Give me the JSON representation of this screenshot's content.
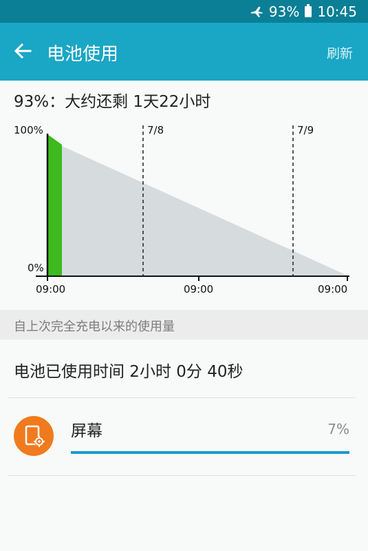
{
  "status_bar": {
    "battery": "93%",
    "time": "10:45",
    "icons": [
      "airplane-mode-icon",
      "battery-icon"
    ]
  },
  "app_bar": {
    "title": "电池使用",
    "refresh_label": "刷新",
    "icon": "back-arrow-icon"
  },
  "summary": {
    "text": "93%：大约还剩 1天22小时"
  },
  "chart_data": {
    "type": "area",
    "y_tick_labels": [
      "100%",
      "0%"
    ],
    "x_tick_labels": [
      "09:00",
      "09:00",
      "09:00"
    ],
    "day_markers": [
      "7/8",
      "7/9"
    ],
    "ylim": [
      0,
      100
    ],
    "series": [
      {
        "values": [
          100,
          93
        ],
        "color": "#3cba1e"
      },
      {
        "values": [
          93,
          0
        ],
        "color": "#d3d8db"
      }
    ]
  },
  "section_header": "自上次完全充电以来的使用量",
  "usage_time": "电池已使用时间 2小时 0分 40秒",
  "apps": [
    {
      "name": "屏幕",
      "percent": "7%",
      "icon": "screen-settings-icon"
    }
  ],
  "usage_bar_fraction": 1.0,
  "colors": {
    "status_bar": "#0a7f96",
    "app_bar": "#1aa6c5",
    "icon_bg": "#f07b1f",
    "bar": "#1a9bd0"
  }
}
